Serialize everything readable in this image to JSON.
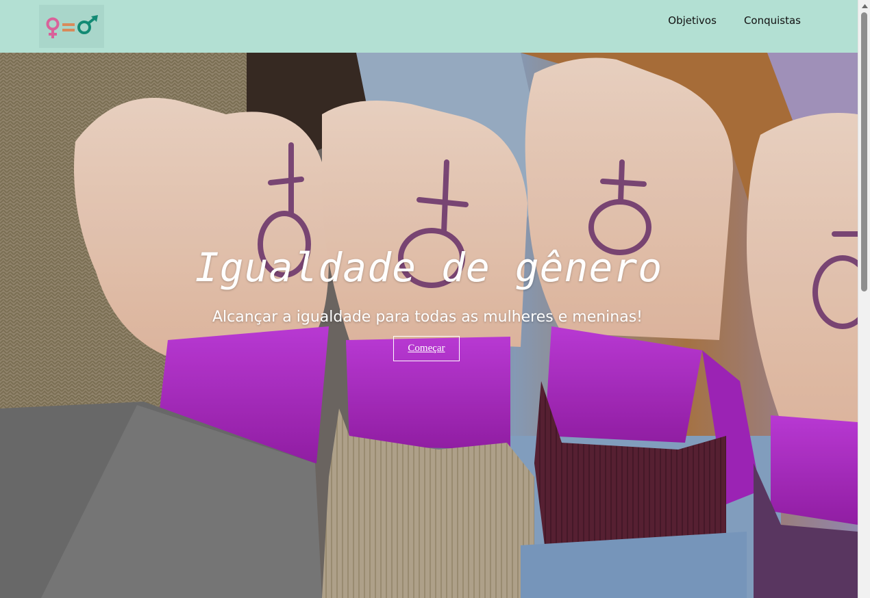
{
  "header": {
    "background": "#b3e0d3",
    "logo": {
      "icon": "gender-equality-logo-icon"
    },
    "nav": [
      {
        "label": "Objetivos"
      },
      {
        "label": "Conquistas"
      }
    ]
  },
  "hero": {
    "title": "Igualdade de gênero",
    "subtitle": "Alcançar a igualdade para todas as mulheres e meninas!",
    "button_label": "Começar",
    "image": "photo-fists-with-female-symbols-and-purple-ribbons",
    "ribbon_color": "#b02ec8"
  },
  "scrollbar": {
    "icon": "scroll-up-arrow-icon"
  }
}
